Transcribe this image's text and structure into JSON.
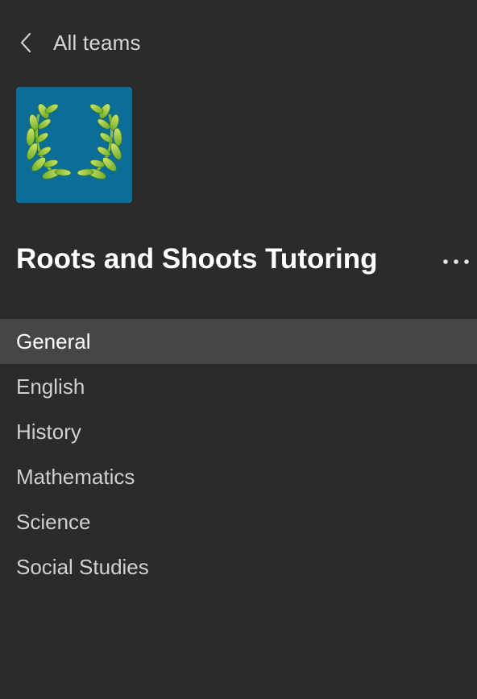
{
  "header": {
    "back_label": "All teams",
    "back_icon": "chevron-left-icon"
  },
  "team": {
    "name": "Roots and Shoots Tutoring",
    "logo_icon": "laurel-wreath-icon",
    "logo_bg_color": "#0a6e96",
    "more_icon": "more-options-icon"
  },
  "channels": [
    {
      "label": "General",
      "active": true
    },
    {
      "label": "English",
      "active": false
    },
    {
      "label": "History",
      "active": false
    },
    {
      "label": "Mathematics",
      "active": false
    },
    {
      "label": "Science",
      "active": false
    },
    {
      "label": "Social Studies",
      "active": false
    }
  ],
  "colors": {
    "background": "#2b2b2b",
    "active_row": "#474646",
    "text_primary": "#ffffff",
    "text_secondary": "#d0d0d0"
  }
}
